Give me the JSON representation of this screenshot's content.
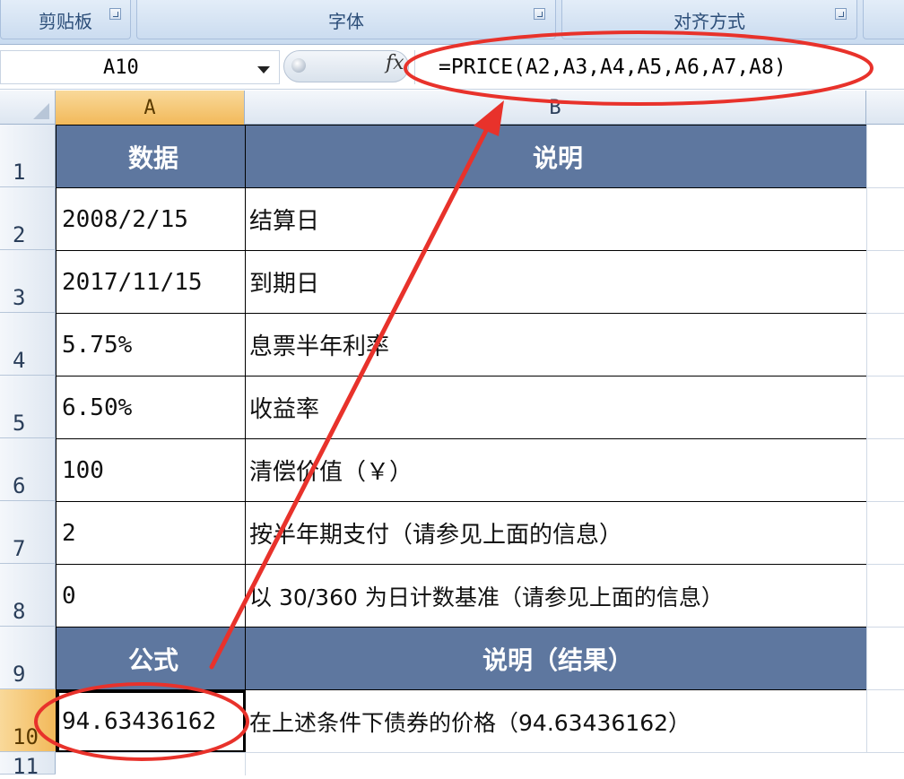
{
  "ribbon": {
    "groups": [
      {
        "label": "剪贴板"
      },
      {
        "label": "字体"
      },
      {
        "label": "对齐方式"
      }
    ]
  },
  "formula_bar": {
    "name_box": "A10",
    "fx": "fx",
    "formula": "=PRICE(A2,A3,A4,A5,A6,A7,A8)"
  },
  "grid": {
    "columns": [
      "A",
      "B"
    ],
    "rows": [
      "1",
      "2",
      "3",
      "4",
      "5",
      "6",
      "7",
      "8",
      "9",
      "10",
      "11"
    ],
    "active_cell": "A10",
    "cells": [
      {
        "a": "数据",
        "b": "说明"
      },
      {
        "a": "2008/2/15",
        "b": "结算日"
      },
      {
        "a": "2017/11/15",
        "b": "到期日"
      },
      {
        "a": "5.75%",
        "b": "息票半年利率"
      },
      {
        "a": "6.50%",
        "b": "收益率"
      },
      {
        "a": "100",
        "b": "清偿价值（￥）"
      },
      {
        "a": "2",
        "b": "按半年期支付（请参见上面的信息）"
      },
      {
        "a": "0",
        "b": "以 30/360 为日计数基准（请参见上面的信息）"
      },
      {
        "a": "公式",
        "b": "说明（结果）"
      },
      {
        "a": "94.63436162",
        "b": "在上述条件下债券的价格（94.63436162）"
      }
    ]
  },
  "colors": {
    "header_fill": "#5e779f",
    "annotation_red": "#e8322b",
    "active_header": "#f2b95a"
  }
}
